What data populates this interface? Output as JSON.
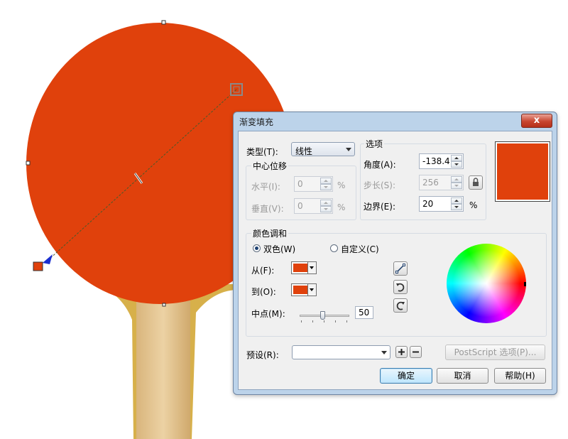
{
  "colors": {
    "paddle_red": "#e0410c",
    "handle_wood": "#e2c18d",
    "rubber_edge": "#d7b04a",
    "handle_dark": "#c9a367"
  },
  "dialog": {
    "title": "渐变填充",
    "close_label": "x",
    "type_label": "类型(T):",
    "type_value": "线性",
    "center_group_label": "中心位移",
    "horizontal_label": "水平(I):",
    "horizontal_value": "0",
    "horizontal_unit": "%",
    "vertical_label": "垂直(V):",
    "vertical_value": "0",
    "vertical_unit": "%",
    "options_group_label": "选项",
    "angle_label": "角度(A):",
    "angle_value": "-138.4",
    "steps_label": "步长(S):",
    "steps_value": "256",
    "edge_label": "边界(E):",
    "edge_value": "20",
    "edge_unit": "%",
    "blend_group_label": "颜色调和",
    "two_color_label": "双色(W)",
    "custom_label": "自定义(C)",
    "from_label": "从(F):",
    "to_label": "到(O):",
    "midpoint_label": "中点(M):",
    "midpoint_value": "50",
    "presets_label": "预设(R):",
    "presets_value": "",
    "postscript_label": "PostScript 选项(P)...",
    "ok_label": "确定",
    "cancel_label": "取消",
    "help_label": "帮助(H)",
    "from_color": "#e0410c",
    "to_color": "#e0410c",
    "preview_color": "#e0410c"
  }
}
